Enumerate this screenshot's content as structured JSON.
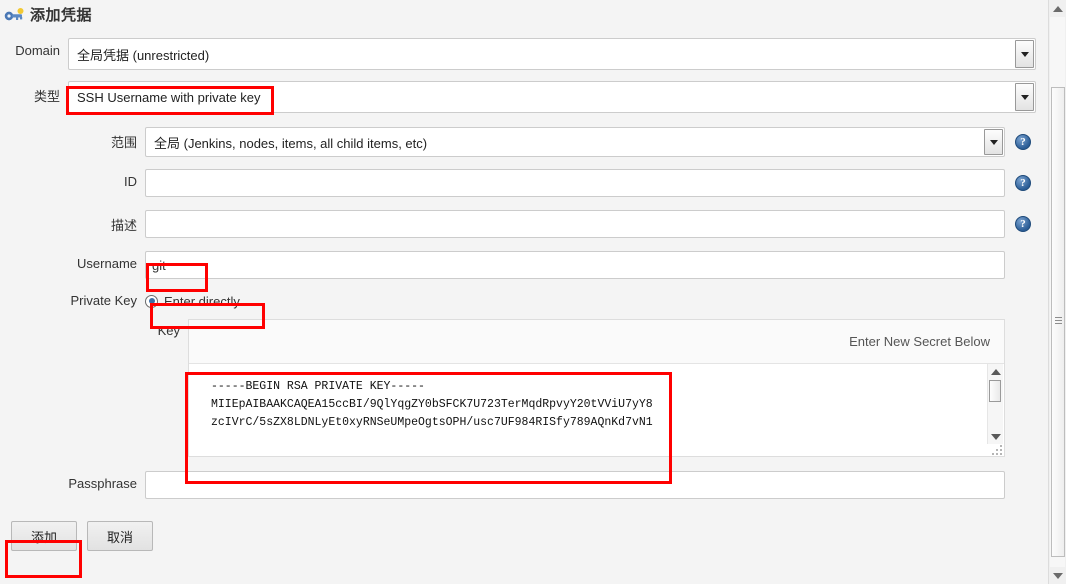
{
  "header": {
    "icon": "key-icon",
    "title": "添加凭据"
  },
  "form": {
    "domain": {
      "label": "Domain",
      "value": "全局凭据 (unrestricted)"
    },
    "kind": {
      "label": "类型",
      "value": "SSH Username with private key"
    },
    "scope": {
      "label": "范围",
      "value": "全局 (Jenkins, nodes, items, all child items, etc)",
      "help": "?"
    },
    "id": {
      "label": "ID",
      "value": "",
      "placeholder": "",
      "help": "?"
    },
    "description": {
      "label": "描述",
      "value": "",
      "placeholder": "",
      "help": "?"
    },
    "username": {
      "label": "Username",
      "value": "git",
      "placeholder": ""
    },
    "private_key": {
      "label": "Private Key",
      "radio_label": "Enter directly",
      "key_label": "Key",
      "secret_notice": "Enter New Secret Below",
      "key_text": "-----BEGIN RSA PRIVATE KEY-----\nMIIEpAIBAAKCAQEA15ccBI/9QlYqgZY0bSFCK7U723TerMqdRpvyY20tVViU7yY8\nzcIVrC/5sZX8LDNLyEt0xyRNSeUMpeOgtsOPH/usc7UF984RISfy789AQnKd7vN1"
    },
    "passphrase": {
      "label": "Passphrase",
      "value": "",
      "placeholder": ""
    }
  },
  "buttons": {
    "submit": "添加",
    "cancel": "取消"
  },
  "annotations": {
    "accent_color": "#ff0000",
    "boxes": [
      "kind-field-highlight",
      "username-field-highlight",
      "enter-directly-highlight",
      "key-textarea-highlight",
      "submit-button-highlight"
    ]
  }
}
